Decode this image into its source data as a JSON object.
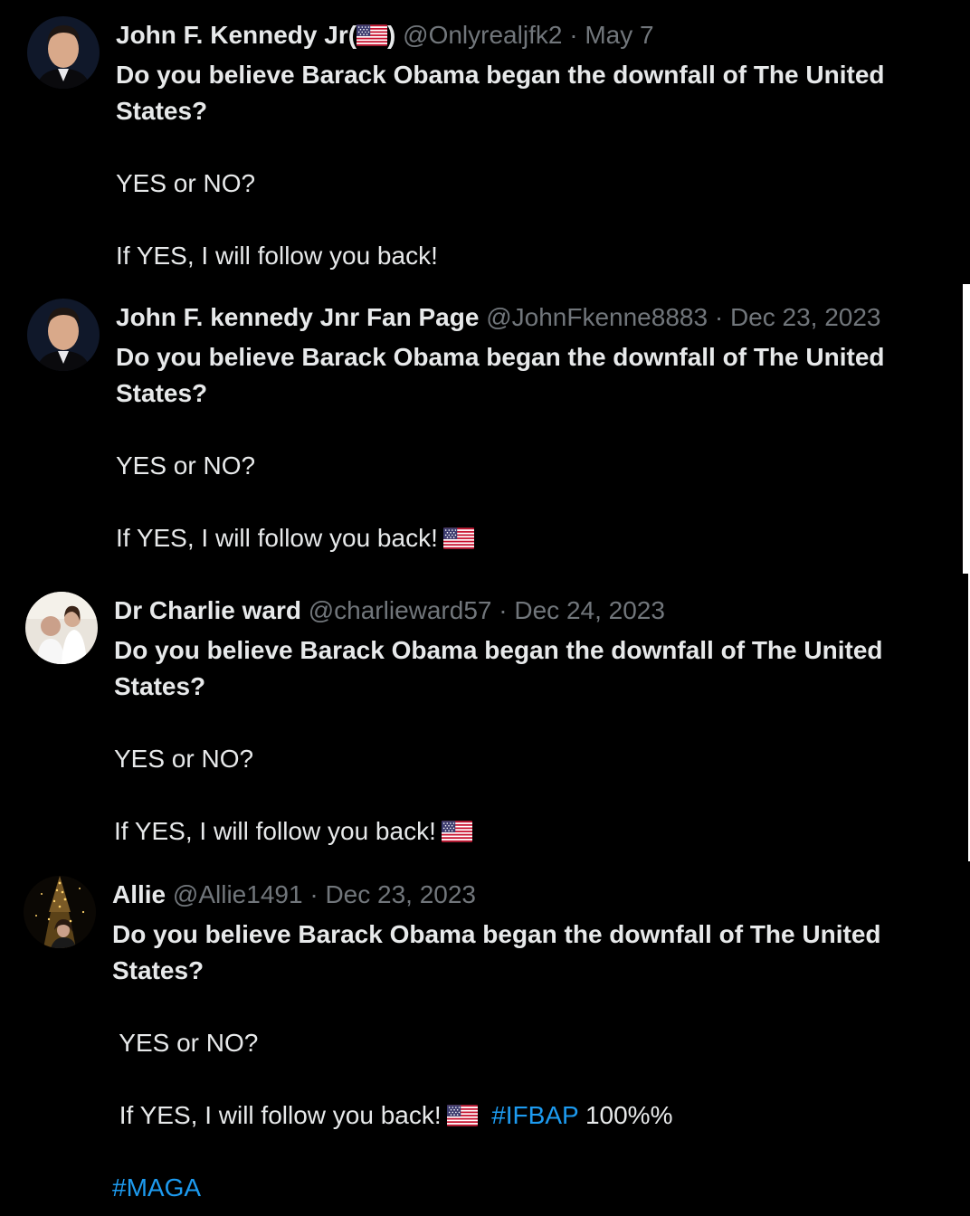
{
  "tweets": [
    {
      "name": "John F. Kennedy Jr(",
      "name_suffix": ")",
      "handle": "@Onlyrealjfk2",
      "date": "May 7",
      "question": "Do you believe Barack Obama began the downfall of The United States?",
      "yes_no": "YES or NO?",
      "follow": "If YES, I will follow you back!"
    },
    {
      "name": "John F. kennedy Jnr Fan Page",
      "handle": "@JohnFkenne8883",
      "date": "Dec 23, 2023",
      "question": "Do you believe Barack Obama began the downfall of The United States?",
      "yes_no": "YES or NO?",
      "follow": "If YES, I will follow you back!"
    },
    {
      "name": "Dr Charlie ward",
      "handle": "@charlieward57",
      "date": "Dec 24, 2023",
      "question": "Do you believe Barack Obama began the downfall of The United States?",
      "yes_no": "YES or NO?",
      "follow": "If YES, I will follow you back!"
    },
    {
      "name": "Allie",
      "handle": "@Allie1491",
      "date": "Dec 23, 2023",
      "question": "Do you believe Barack Obama began the downfall of The United States?",
      "yes_no": " YES or NO?",
      "follow": " If YES, I will follow you back!",
      "hashtag1": "#IFBAP",
      "after_hashtag": "100%%",
      "hashtag2": "#MAGA"
    }
  ],
  "separator": "·",
  "icons": {
    "flag": "us-flag-icon"
  },
  "colors": {
    "background": "#000000",
    "text": "#e7e9ea",
    "secondary": "#71767b",
    "link": "#1d9bf0"
  }
}
